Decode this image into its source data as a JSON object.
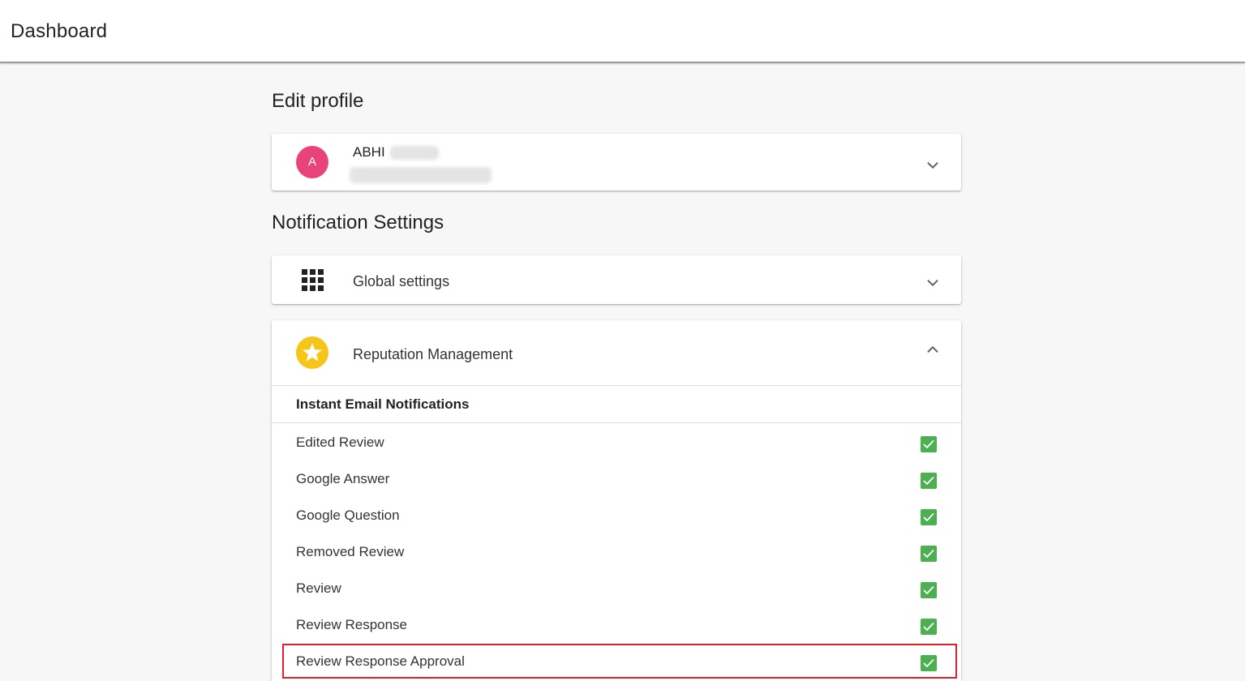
{
  "header": {
    "title": "Dashboard"
  },
  "edit_profile": {
    "heading": "Edit profile",
    "avatar_initial": "A",
    "name": "ABHI"
  },
  "notifications": {
    "heading": "Notification Settings",
    "global": {
      "label": "Global settings"
    },
    "reputation": {
      "label": "Reputation Management",
      "subheading": "Instant Email Notifications",
      "items": [
        {
          "label": "Edited Review",
          "checked": true
        },
        {
          "label": "Google Answer",
          "checked": true
        },
        {
          "label": "Google Question",
          "checked": true
        },
        {
          "label": "Removed Review",
          "checked": true
        },
        {
          "label": "Review",
          "checked": true
        },
        {
          "label": "Review Response",
          "checked": true
        },
        {
          "label": "Review Response Approval",
          "checked": true
        }
      ]
    }
  },
  "colors": {
    "avatar": "#e8437a",
    "star_badge": "#f5c518",
    "checkbox": "#4caf50",
    "highlight": "#e0202a"
  }
}
